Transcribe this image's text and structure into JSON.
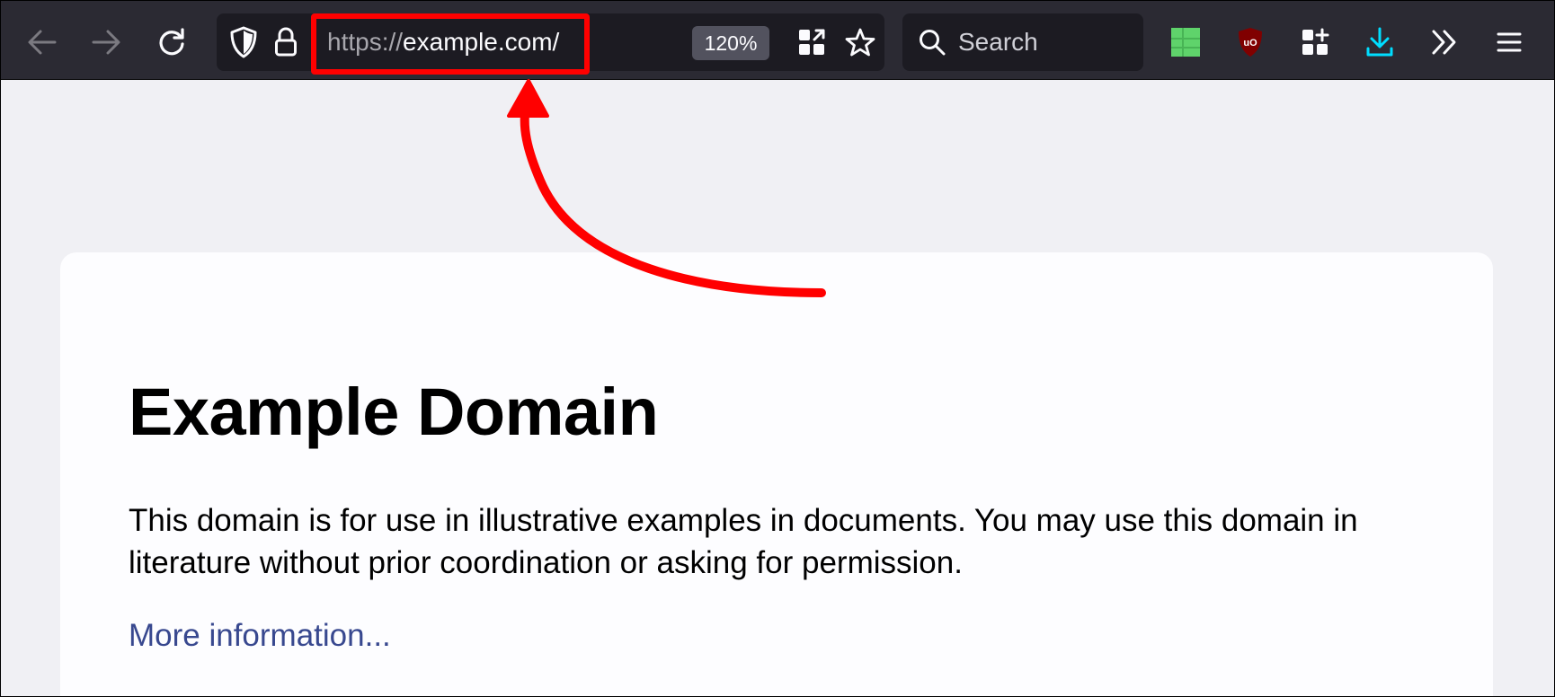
{
  "toolbar": {
    "url_scheme": "https://",
    "url_host": "example.com/",
    "zoom": "120%",
    "search_placeholder": "Search",
    "icons": [
      "back-arrow-icon",
      "forward-arrow-icon",
      "reload-icon",
      "shield-icon",
      "lock-icon",
      "page-action-icon",
      "bookmark-star-icon",
      "search-icon",
      "extension-green-icon",
      "ublock-origin-icon",
      "extensions-icon",
      "downloads-icon",
      "overflow-chevrons-icon",
      "menu-icon"
    ]
  },
  "page": {
    "title": "Example Domain",
    "paragraph": "This domain is for use in illustrative examples in documents. You may use this domain in literature without prior coordination or asking for permission.",
    "link_text": "More information..."
  },
  "colors": {
    "toolbar_bg": "#2b2a33",
    "field_bg": "#1c1b22",
    "annotation_red": "#ff0000",
    "link_blue": "#38488f",
    "download_accent": "#00ddff",
    "ublock_red": "#800000",
    "green_extension": "#5fd36b"
  }
}
